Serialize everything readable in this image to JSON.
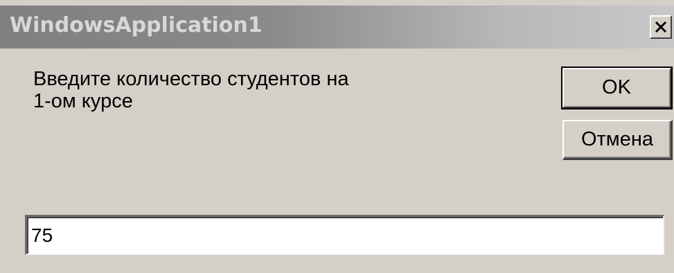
{
  "window": {
    "title": "WindowsApplication1",
    "close_icon": "close-x-icon"
  },
  "dialog": {
    "prompt": "Введите  количество  студентов на\n1-ом  курсе",
    "ok_label": "OK",
    "cancel_label": "Отмена",
    "input_value": "75"
  },
  "colors": {
    "face": "#d4d0c8",
    "titlebar_start": "#808080",
    "titlebar_end": "#c8c8c8",
    "title_text": "#d8d8d8"
  }
}
